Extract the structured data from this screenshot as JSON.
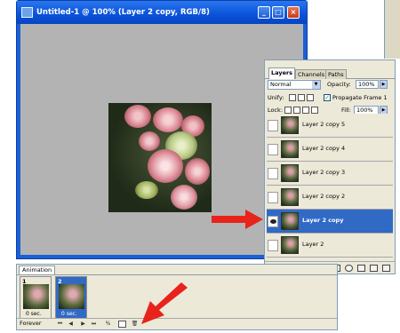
{
  "document": {
    "title": "Untitled-1 @ 100% (Layer 2 copy, RGB/8)",
    "minimize_label": "_",
    "maximize_label": "□",
    "close_label": "×"
  },
  "layers_panel": {
    "tabs": [
      "Layers",
      "Channels",
      "Paths"
    ],
    "blend_mode": "Normal",
    "opacity_label": "Opacity:",
    "opacity_value": "100%",
    "unify_label": "Unify:",
    "propagate_label": "Propagate Frame 1",
    "lock_label": "Lock:",
    "fill_label": "Fill:",
    "fill_value": "100%",
    "layers": [
      {
        "name": "Layer 2 copy 5",
        "visible": false,
        "selected": false
      },
      {
        "name": "Layer 2 copy 4",
        "visible": false,
        "selected": false
      },
      {
        "name": "Layer 2 copy 3",
        "visible": false,
        "selected": false
      },
      {
        "name": "Layer 2 copy 2",
        "visible": false,
        "selected": false
      },
      {
        "name": "Layer 2 copy",
        "visible": true,
        "selected": true
      },
      {
        "name": "Layer 2",
        "visible": false,
        "selected": false
      }
    ]
  },
  "animation_panel": {
    "tab": "Animation",
    "loop": "Forever",
    "frames": [
      {
        "number": "1",
        "delay": "0 sec.",
        "selected": false
      },
      {
        "number": "2",
        "delay": "0 sec.",
        "selected": true
      }
    ]
  },
  "colors": {
    "titlebar": "#0a52d9",
    "selection": "#316ac5",
    "canvas_bg": "#b3b3b3",
    "panel_bg": "#ece9d8",
    "arrow": "#e8231b"
  }
}
